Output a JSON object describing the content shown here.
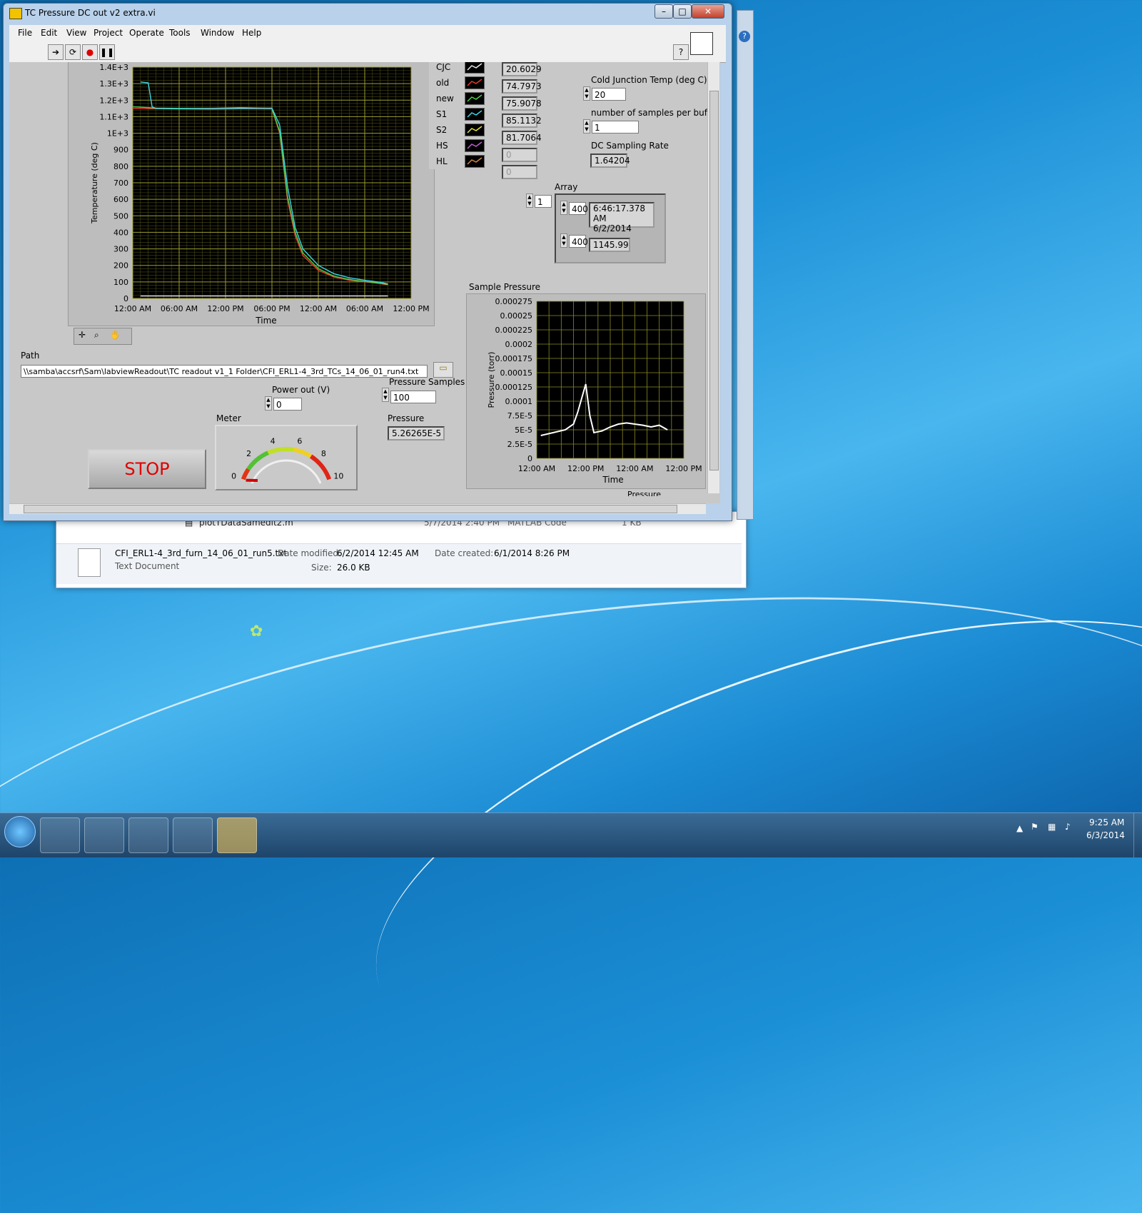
{
  "window": {
    "title": "TC Pressure DC out v2 extra.vi"
  },
  "menu": [
    "File",
    "Edit",
    "View",
    "Project",
    "Operate",
    "Tools",
    "Window",
    "Help"
  ],
  "legend": {
    "items": [
      {
        "name": "CJC",
        "value": "20.6029",
        "color": "#e8e8e8"
      },
      {
        "name": "old",
        "value": "74.7973",
        "color": "#e83a2a"
      },
      {
        "name": "new",
        "value": "75.9078",
        "color": "#4bd34b"
      },
      {
        "name": "S1",
        "value": "85.1132",
        "color": "#3cd7e8"
      },
      {
        "name": "S2",
        "value": "81.7064",
        "color": "#e6e63a"
      },
      {
        "name": "HS",
        "value": "0",
        "color": "#c060d0"
      },
      {
        "name": "HL",
        "value": "0",
        "color": "#d08a40"
      }
    ]
  },
  "controls": {
    "cold_junction_label": "Cold Junction Temp (deg C)",
    "cold_junction_value": "20",
    "samples_per_buffer_label": "number of samples per buffer",
    "samples_per_buffer_value": "1",
    "dc_sampling_rate_label": "DC Sampling Rate",
    "dc_sampling_rate_value": "1.64204",
    "array_label": "Array",
    "array_index": "1",
    "array_row1_index": "400",
    "array_row1_value_time": "6:46:17.378 AM",
    "array_row1_value_date": "6/2/2014",
    "array_row2_index": "400",
    "array_row2_value": "1145.99",
    "path_label": "Path",
    "path_value": "\\\\samba\\accsrf\\Sam\\labviewReadout\\TC readout v1_1 Folder\\CFI_ERL1-4_3rd_TCs_14_06_01_run4.txt",
    "power_out_label": "Power out (V)",
    "power_out_value": "0",
    "pressure_samples_label": "Pressure Samples",
    "pressure_samples_value": "100",
    "pressure_label": "Pressure",
    "pressure_value": "5.26265E-5",
    "meter_label": "Meter",
    "stop_label": "STOP",
    "sample_pressure_label": "Sample Pressure",
    "pressure_legend_label": "Pressure"
  },
  "meter": {
    "ticks": [
      "0",
      "2",
      "4",
      "6",
      "8",
      "10"
    ],
    "value": 0
  },
  "explorer": {
    "row1_name": "plotTDataSamedit2.m",
    "row1_date": "5/7/2014 2:40 PM",
    "row1_type": "MATLAB Code",
    "row1_size": "1 KB",
    "file_name": "CFI_ERL1-4_3rd_furn_14_06_01_run5.txt",
    "file_type": "Text Document",
    "date_modified_label": "Date modified:",
    "date_modified": "6/2/2014 12:45 AM",
    "date_created_label": "Date created:",
    "date_created": "6/1/2014 8:26 PM",
    "size_label": "Size:",
    "size": "26.0 KB"
  },
  "tray": {
    "time": "9:25 AM",
    "date": "6/3/2014"
  },
  "chart_data": [
    {
      "type": "line",
      "title": "",
      "xlabel": "Time",
      "ylabel": "Temperature (deg C)",
      "x_ticks": [
        "12:00 AM",
        "06:00 AM",
        "12:00 PM",
        "06:00 PM",
        "12:00 AM",
        "06:00 AM",
        "12:00 PM"
      ],
      "y_ticks": [
        "0",
        "100",
        "200",
        "300",
        "400",
        "500",
        "600",
        "700",
        "800",
        "900",
        "1E+3",
        "1.1E+3",
        "1.2E+3",
        "1.3E+3",
        "1.4E+3"
      ],
      "ylim": [
        0,
        1400
      ],
      "x_hours": [
        0,
        36
      ],
      "grid": true,
      "series": [
        {
          "name": "old",
          "color": "#e83a2a",
          "x": [
            0,
            1,
            2,
            3,
            6,
            10,
            14,
            18,
            19,
            20,
            21,
            22,
            24,
            26,
            28,
            30,
            32,
            33
          ],
          "y": [
            1150,
            1150,
            1148,
            1148,
            1147,
            1145,
            1148,
            1147,
            1000,
            600,
            380,
            260,
            170,
            130,
            110,
            100,
            90,
            82
          ]
        },
        {
          "name": "new",
          "color": "#4bd34b",
          "x": [
            0,
            1,
            2,
            3,
            6,
            10,
            14,
            18,
            19,
            20,
            21,
            22,
            24,
            26,
            28,
            30,
            32,
            33
          ],
          "y": [
            1160,
            1158,
            1155,
            1152,
            1150,
            1150,
            1155,
            1150,
            1010,
            620,
            400,
            275,
            180,
            135,
            115,
            103,
            92,
            85
          ]
        },
        {
          "name": "S1",
          "color": "#3cd7e8",
          "x": [
            1,
            2,
            2.5,
            3,
            6,
            10,
            14,
            18,
            19,
            20,
            21,
            22,
            24,
            26,
            28,
            30,
            32,
            33
          ],
          "y": [
            1310,
            1305,
            1160,
            1150,
            1148,
            1150,
            1150,
            1152,
            1050,
            680,
            430,
            300,
            200,
            150,
            125,
            110,
            98,
            88
          ]
        },
        {
          "name": "CJC",
          "color": "#e8e8e8",
          "x": [
            1,
            33
          ],
          "y": [
            15,
            15
          ]
        }
      ]
    },
    {
      "type": "line",
      "title": "Sample Pressure",
      "xlabel": "Time",
      "ylabel": "Pressure (torr)",
      "x_ticks": [
        "12:00 AM",
        "12:00 PM",
        "12:00 AM",
        "12:00 PM"
      ],
      "y_ticks": [
        "0",
        "2.5E-5",
        "5E-5",
        "7.5E-5",
        "0.0001",
        "0.000125",
        "0.00015",
        "0.000175",
        "0.0002",
        "0.000225",
        "0.00025",
        "0.000275"
      ],
      "ylim": [
        0,
        0.000275
      ],
      "grid": true,
      "series": [
        {
          "name": "Pressure",
          "color": "#ffffff",
          "x": [
            1,
            4,
            7,
            9,
            10,
            11,
            12,
            13,
            14,
            16,
            18,
            20,
            22,
            24,
            26,
            28,
            30,
            32
          ],
          "y": [
            4e-05,
            4.5e-05,
            5e-05,
            6e-05,
            8e-05,
            0.000105,
            0.00013,
            7.5e-05,
            4.5e-05,
            4.8e-05,
            5.5e-05,
            6e-05,
            6.2e-05,
            6e-05,
            5.8e-05,
            5.5e-05,
            5.8e-05,
            5e-05
          ]
        }
      ]
    }
  ]
}
